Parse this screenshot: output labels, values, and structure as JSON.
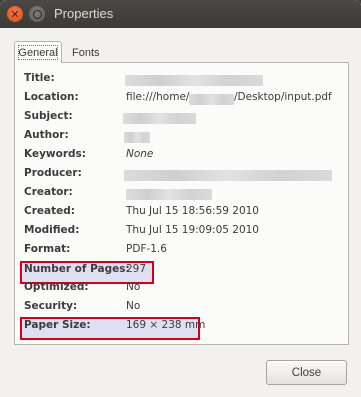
{
  "window": {
    "title": "Properties"
  },
  "tabs": [
    {
      "label": "General",
      "selected": true
    },
    {
      "label": "Fonts",
      "selected": false
    }
  ],
  "fields": {
    "title": {
      "label": "Title:",
      "value": ""
    },
    "location": {
      "label": "Location:",
      "prefix": "file:///home/",
      "suffix": "/Desktop/input.pdf"
    },
    "subject": {
      "label": "Subject:",
      "value": ""
    },
    "author": {
      "label": "Author:",
      "value": ""
    },
    "keywords": {
      "label": "Keywords:",
      "value": "None"
    },
    "producer": {
      "label": "Producer:",
      "value": ""
    },
    "creator": {
      "label": "Creator:",
      "value": ""
    },
    "created": {
      "label": "Created:",
      "value": "Thu Jul 15 18:56:59 2010"
    },
    "modified": {
      "label": "Modified:",
      "value": "Thu Jul 15 19:09:05 2010"
    },
    "format": {
      "label": "Format:",
      "value": "PDF-1.6"
    },
    "pages": {
      "label": "Number of Pages:",
      "value": "297"
    },
    "optimized": {
      "label": "Optimized:",
      "value": "No"
    },
    "security": {
      "label": "Security:",
      "value": "No"
    },
    "paper_size": {
      "label": "Paper Size:",
      "value": "169 × 238 mm"
    }
  },
  "buttons": {
    "close_label": "Close"
  },
  "colors": {
    "highlight_border": "#d4001b",
    "titlebar": "#3c3b37",
    "window_bg": "#f2f1f0"
  }
}
